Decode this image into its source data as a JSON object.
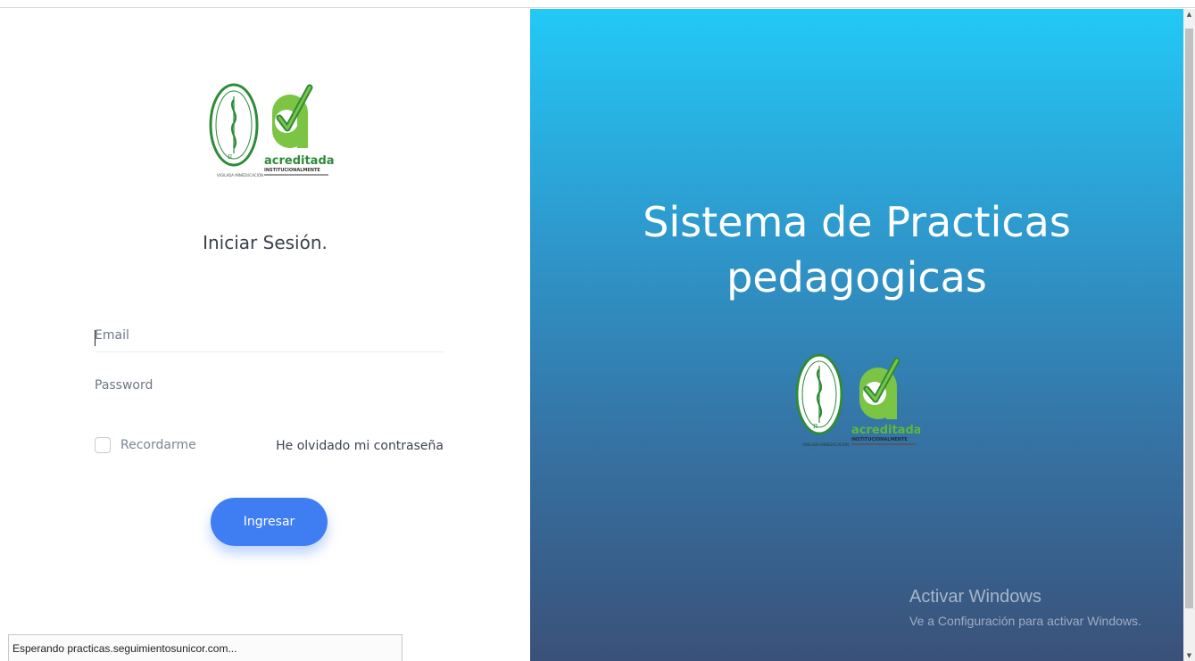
{
  "logo": {
    "seal_text": "UNIVERSIDAD DE CÓRDOBA",
    "seal_motto": "VIGILADA MINEDUCACIÓN",
    "brand_word": "acreditada",
    "brand_sub": "INSTITUCIONALMENTE"
  },
  "login": {
    "title": "Iniciar Sesión.",
    "email_placeholder": "Email",
    "password_placeholder": "Password",
    "remember_label": "Recordarme",
    "forgot_label": "He olvidado mi contraseña",
    "submit_label": "Ingresar"
  },
  "status_bar": {
    "text": "Esperando practicas.seguimientosunicor.com..."
  },
  "hero": {
    "line1": "Sistema de Practicas",
    "line2": "pedagogicas"
  },
  "windows_watermark": {
    "title": "Activar Windows",
    "subtitle": "Ve a Configuración para activar Windows."
  },
  "colors": {
    "button": "#3f7ef2",
    "gradient_top": "#23c9f6",
    "gradient_bottom": "#3a5179",
    "seal_green": "#2e8b3a",
    "brand_green": "#7cc443"
  }
}
